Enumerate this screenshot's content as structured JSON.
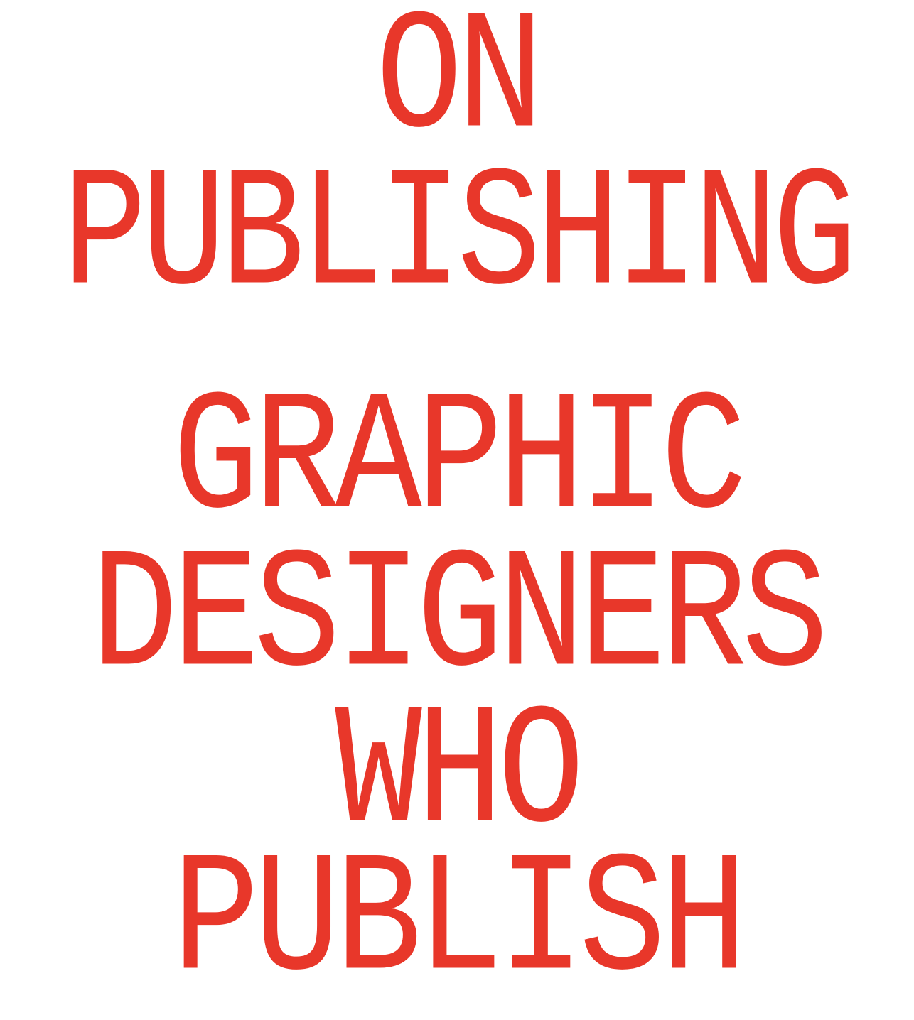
{
  "colors": {
    "background": "#ffffff",
    "text": "#e8372a"
  },
  "title_block": {
    "line1": "ON",
    "line2": "PUBLISHING"
  },
  "subtitle_block": {
    "line1": "GRAPHIC",
    "line2": "DESIGNERS",
    "line3": "WHO",
    "line4": "PUBLISH"
  }
}
